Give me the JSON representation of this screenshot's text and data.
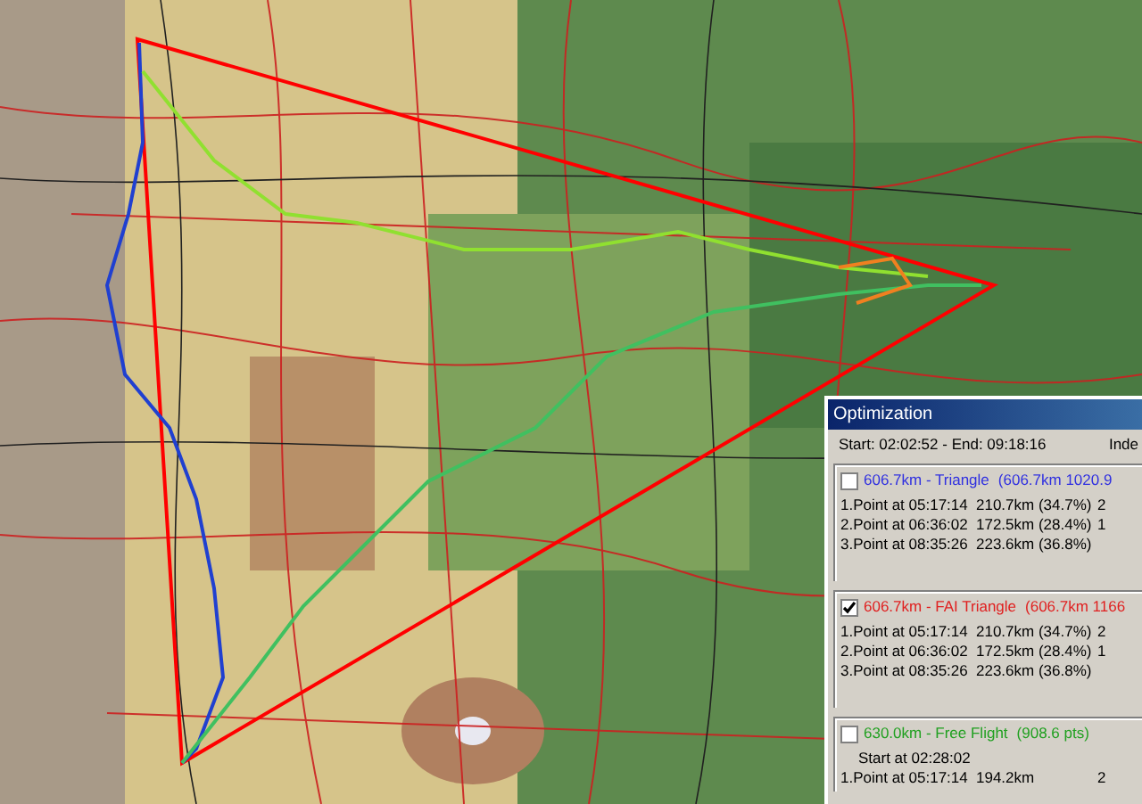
{
  "window": {
    "title": "Optimization"
  },
  "summary": "Start: 02:02:52 - End: 09:18:16",
  "summary_column_2": "Inde",
  "results": [
    {
      "checked": false,
      "color": "#3030e0",
      "title": "606.7km - Triangle",
      "detail": "(606.7km  1020.9",
      "rows": [
        {
          "point": "1.Point at 05:17:14",
          "distance": "210.7km (34.7%)",
          "column_3": "2"
        },
        {
          "point": "2.Point at 06:36:02",
          "distance": "172.5km (28.4%)",
          "column_3": "1"
        },
        {
          "point": "3.Point at 08:35:26",
          "distance": "223.6km (36.8%)"
        }
      ]
    },
    {
      "checked": true,
      "color": "#e02020",
      "title": "606.7km - FAI Triangle",
      "detail": "(606.7km  1166",
      "rows": [
        {
          "point": "1.Point at 05:17:14",
          "distance": "210.7km (34.7%)",
          "column_3": "2"
        },
        {
          "point": "2.Point at 06:36:02",
          "distance": "172.5km (28.4%)",
          "column_3": "1"
        },
        {
          "point": "3.Point at 08:35:26",
          "distance": "223.6km (36.8%)"
        }
      ]
    },
    {
      "checked": false,
      "color": "#20a020",
      "title": "630.0km - Free Flight",
      "detail": "(908.6 pts)",
      "start": "Start at 02:28:02",
      "rows": [
        {
          "point": "1.Point at 05:17:14",
          "distance": "194.2km",
          "column_3": "2"
        }
      ]
    }
  ]
}
